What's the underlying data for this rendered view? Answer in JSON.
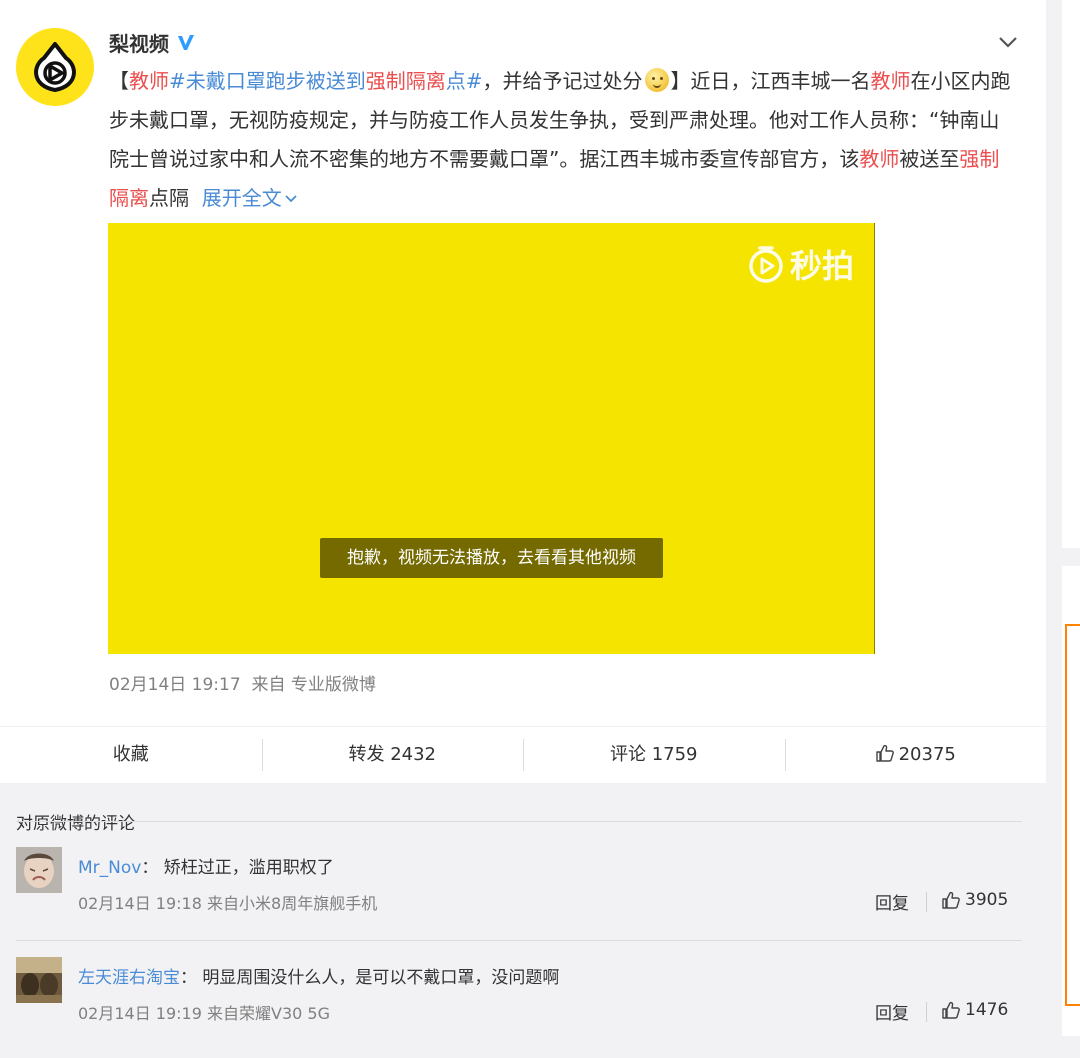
{
  "post": {
    "author": "梨视频",
    "text_segments": {
      "open_bracket": "【",
      "tag_a": "教师",
      "tag_b": "#未戴口罩跑步被送到",
      "tag_c": "强制隔离",
      "tag_d": "点#",
      "after_tag": "，并给予记过处分",
      "close_bracket": "】近日，江西丰城一名",
      "teacher_1": "教师",
      "body_1": "在小区内跑步未戴口罩，无视防疫规定，并与防疫工作人员发生争执，受到严肃处理。他对工作人员称：“钟南山院士曾说过家中和人流不密集的地方不需要戴口罩”。据江西丰城市委宣传部官方，该",
      "teacher_2": "教师",
      "body_2": "被送至",
      "quarantine": "强制隔离",
      "body_3": "点隔",
      "expand": "展开全文"
    },
    "video_watermark": "秒拍",
    "video_message": "抱歉，视频无法播放，去看看其他视频",
    "timestamp": "02月14日 19:17",
    "source": "来自 专业版微博"
  },
  "actions": {
    "favorite": "收藏",
    "repost": "转发 2432",
    "comment": "评论 1759",
    "like": "20375"
  },
  "comments_section": {
    "title": "对原微博的评论",
    "items": [
      {
        "user": "Mr_Nov",
        "separator": "：",
        "text": "矫枉过正，滥用职权了",
        "time": "02月14日 19:18",
        "source": "来自小米8周年旗舰手机",
        "reply": "回复",
        "likes": "3905"
      },
      {
        "user": "左天涯右淘宝",
        "separator": "：",
        "text": "明显周围没什么人，是可以不戴口罩，没问题啊",
        "time": "02月14日 19:19",
        "source": "来自荣耀V30 5G",
        "reply": "回复",
        "likes": "1476"
      }
    ]
  },
  "colors": {
    "accent_orange": "#ff8200",
    "link_blue": "#4a8bd6",
    "topic_red": "#eb4e4e",
    "video_yellow": "#f5e300"
  }
}
